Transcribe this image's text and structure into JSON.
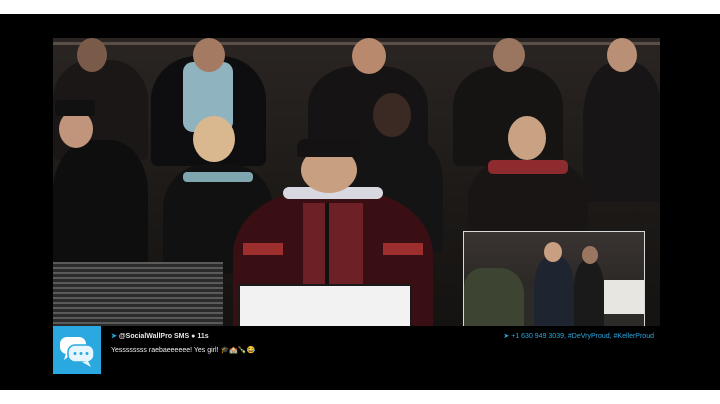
{
  "ticker": {
    "icon": "chat-bubbles-icon",
    "handle_prefix": "@SocialWallPro SMS",
    "elapsed": "11s",
    "message": "Yessssssss raebaeeeeee! Yes girl!",
    "message_emojis": "🎓🏫🍾😂",
    "hashtags": "+1 630 949 3039, #DeVryProud, #KellerProud",
    "accent_color": "#2aa8e0"
  }
}
